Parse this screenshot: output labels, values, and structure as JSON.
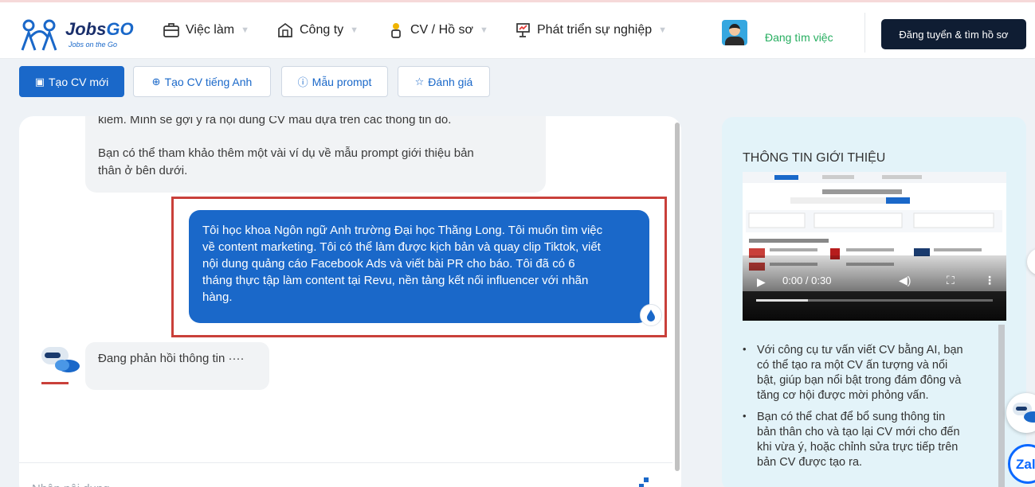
{
  "brand": {
    "name_a": "Jobs",
    "name_b": "GO",
    "tagline": "Jobs on the Go"
  },
  "nav": {
    "items": [
      {
        "label": "Việc làm",
        "icon": "briefcase-icon"
      },
      {
        "label": "Công ty",
        "icon": "building-icon"
      },
      {
        "label": "CV / Hồ sơ",
        "icon": "person-cv-icon"
      },
      {
        "label": "Phát triển sự nghiệp",
        "icon": "career-icon"
      }
    ],
    "status": "Đang tìm việc",
    "post_button": "Đăng tuyển & tìm hồ sơ"
  },
  "toolbar": {
    "new_cv": "Tạo CV mới",
    "english_cv": "Tạo CV tiếng Anh",
    "prompt_sample": "Mẫu prompt",
    "rate": "Đánh giá"
  },
  "chat": {
    "bot_message_lines": [
      "kiếm. Mình sẽ gợi ý rà nội dung CV mẫu dựa trên các thông tin đó.",
      "Bạn có thể tham khảo thêm một vài ví dụ về mẫu prompt giới thiệu bản",
      "thân ở bên dưới."
    ],
    "user_message_lines": [
      "Tôi học khoa Ngôn ngữ Anh trường Đại học Thăng Long. Tôi muốn tìm việc",
      "về content marketing. Tôi có thể làm được kịch bản và quay clip Tiktok, viết",
      "nội dung quảng cáo Facebook Ads và viết bài PR cho báo. Tôi đã có 6",
      "tháng thực tập làm content tại Revu, nền tảng kết nối influencer với nhãn",
      "hàng."
    ],
    "typing": "Đang phản hồi thông tin ····",
    "input_placeholder": "Nhập nội dung"
  },
  "intro": {
    "title": "THÔNG TIN GIỚI THIỆU",
    "video_time": "0:00 / 0:30",
    "video_progress": 0.22,
    "bullets": [
      [
        "Với công cụ tư vấn viết CV bằng AI, bạn",
        "có thể tạo ra một CV ấn tượng và nổi",
        "bật, giúp bạn nổi bật trong đám đông và",
        "tăng cơ hội được mời phỏng vấn."
      ],
      [
        "Bạn có thể chat để bổ sung thông tin",
        "bản thân cho và tạo lại CV mới cho đến",
        "khi vừa ý, hoặc chỉnh sửa trực tiếp trên",
        "bản CV được tạo ra."
      ]
    ]
  },
  "floating": {
    "zalo": "Zal"
  },
  "colors": {
    "primary": "#1a68c9",
    "dark": "#0f1d33",
    "status_green": "#27ae60",
    "highlight_red": "#c9403a",
    "panel_bg": "#e3f3f9"
  }
}
